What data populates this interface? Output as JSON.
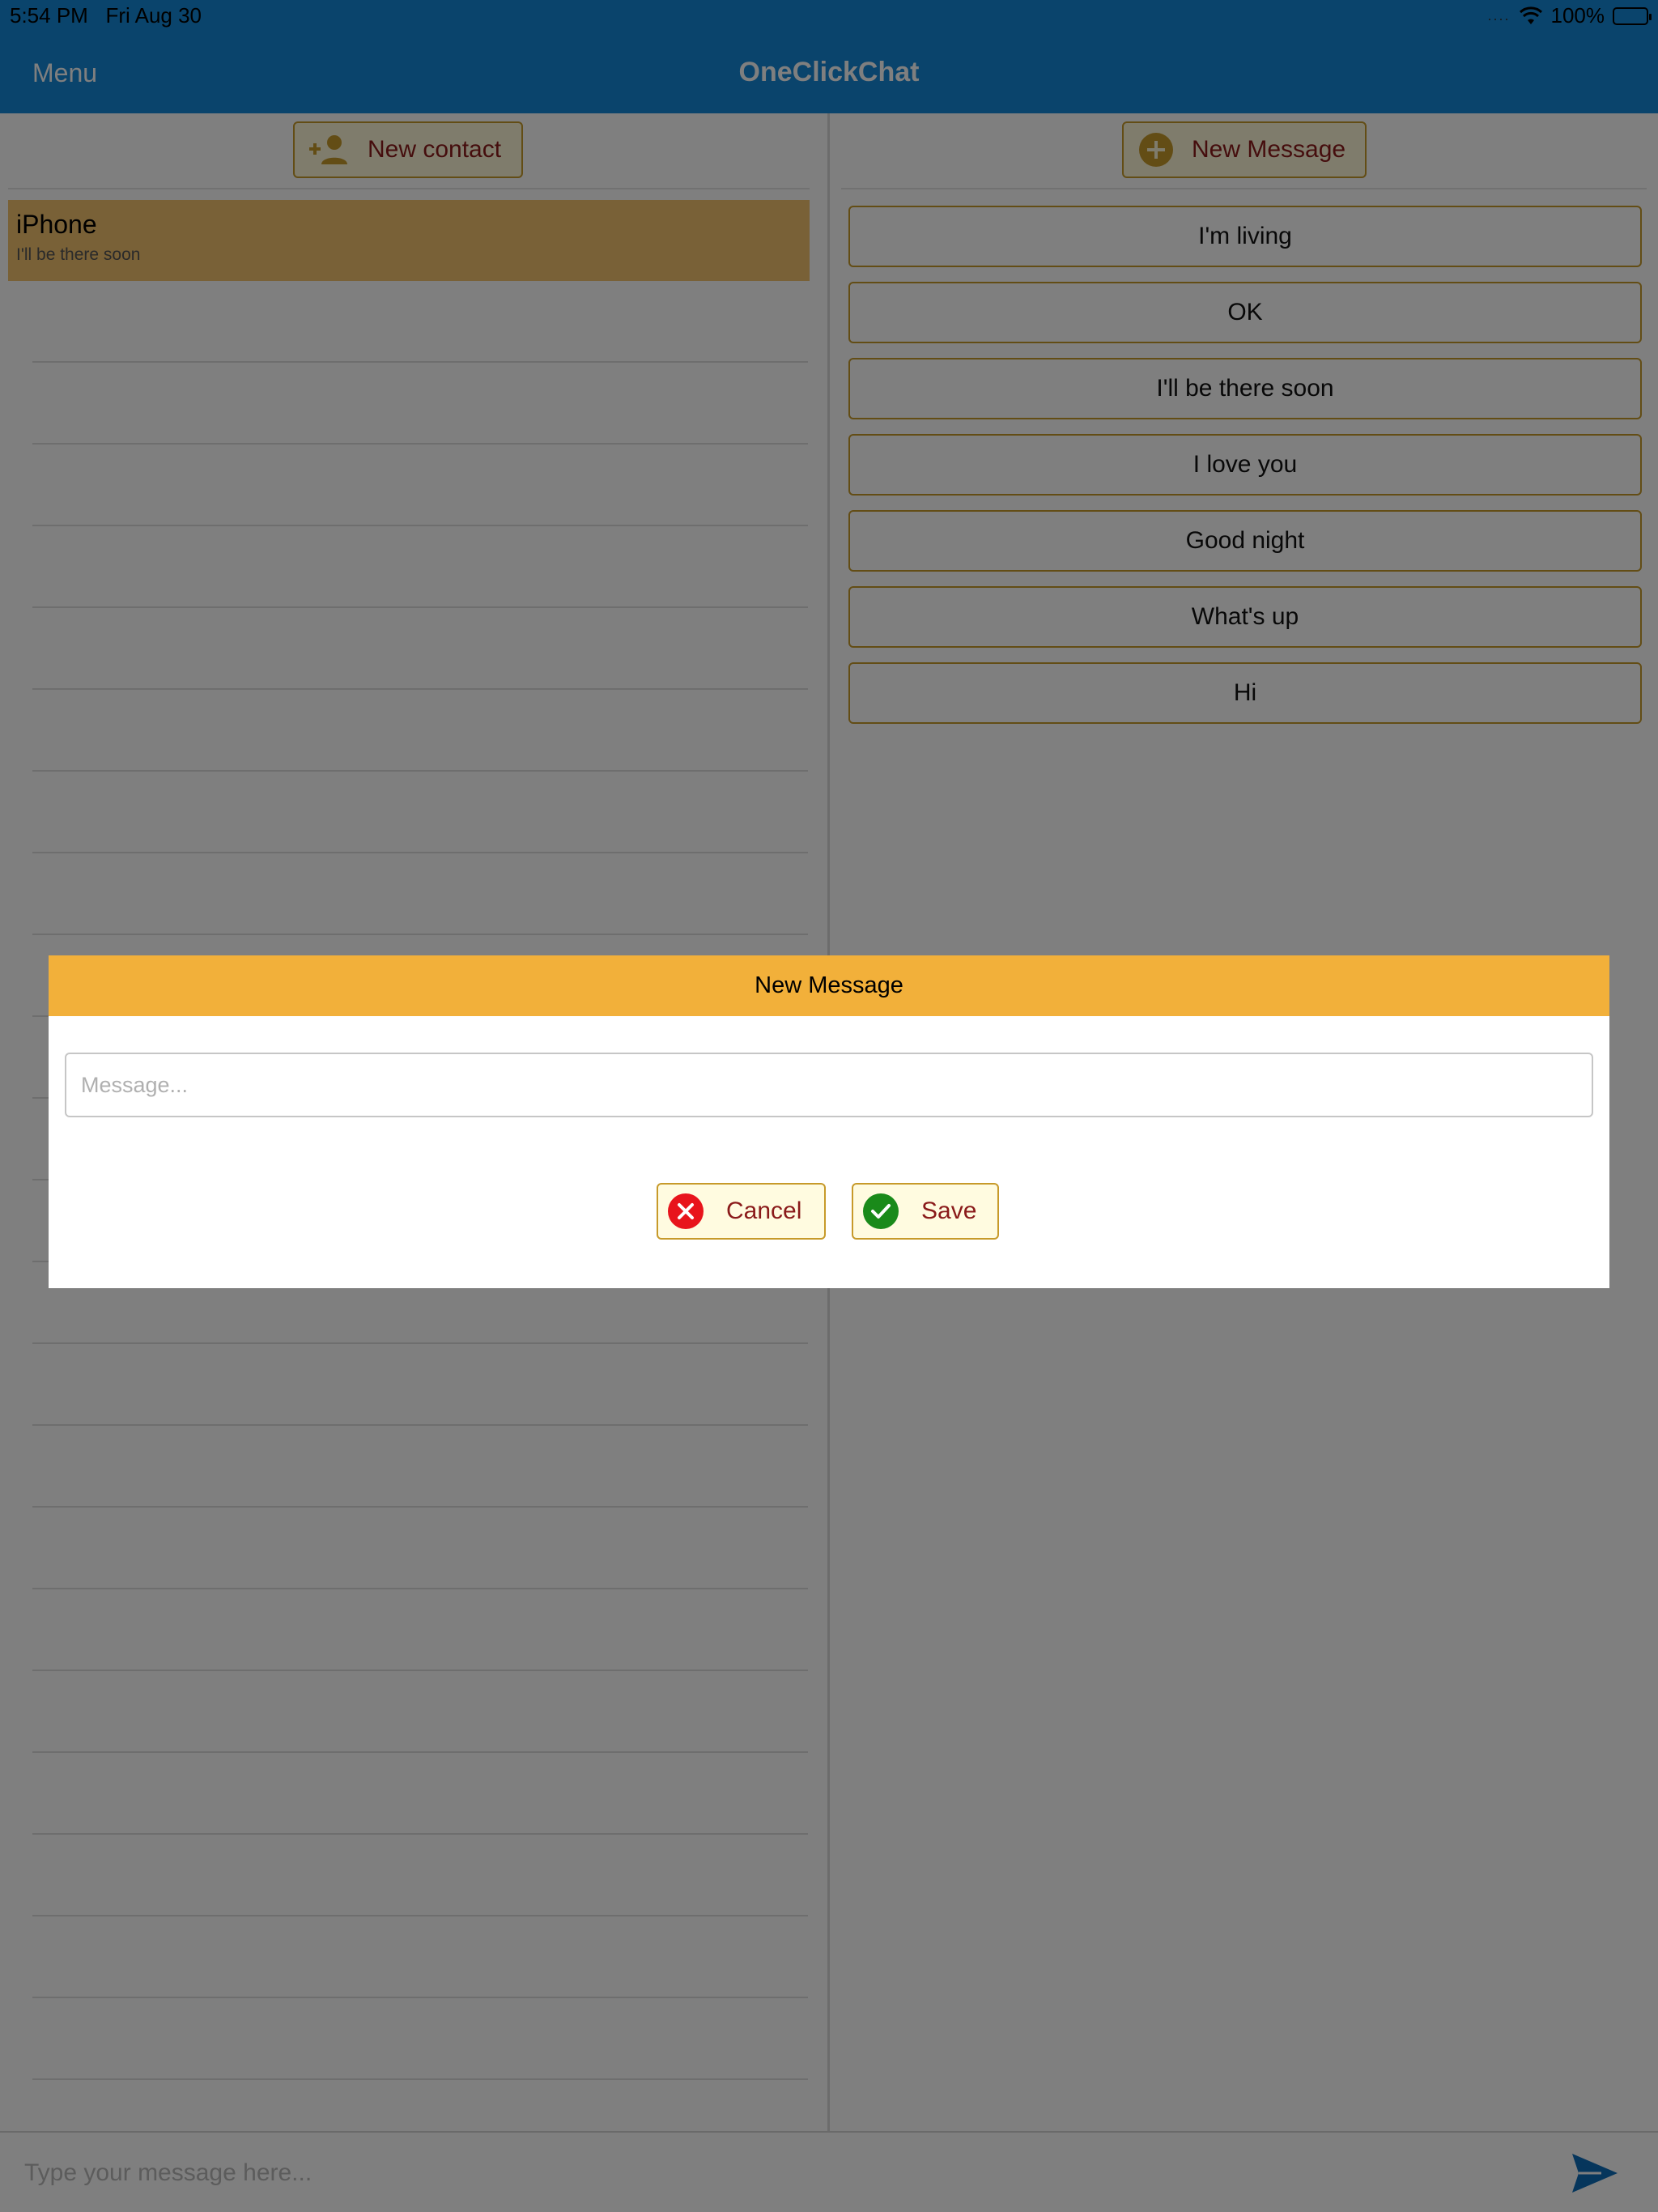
{
  "status_bar": {
    "time": "5:54 PM",
    "date": "Fri Aug 30",
    "signal": "....",
    "battery_text": "100%"
  },
  "nav": {
    "menu_label": "Menu",
    "title": "OneClickChat"
  },
  "contacts": {
    "new_contact_label": "New contact",
    "items": [
      {
        "name": "iPhone",
        "last_message": "I'll be there soon"
      }
    ]
  },
  "messages": {
    "new_message_label": "New Message",
    "items": [
      {
        "label": "I'm living"
      },
      {
        "label": "OK"
      },
      {
        "label": "I'll be there soon"
      },
      {
        "label": "I love you"
      },
      {
        "label": "Good night"
      },
      {
        "label": "What's up"
      },
      {
        "label": "Hi"
      }
    ]
  },
  "composer": {
    "placeholder": "Type your message here..."
  },
  "dialog": {
    "title": "New Message",
    "input_placeholder": "Message...",
    "cancel_label": "Cancel",
    "save_label": "Save"
  },
  "colors": {
    "nav_bar": "#1488d8",
    "accent_orange": "#f2b03a",
    "button_border": "#c79a2a",
    "button_text": "#8a1a1a",
    "cancel_red": "#e8141c",
    "save_green": "#1a8a1a",
    "send_blue": "#0d6db8"
  }
}
